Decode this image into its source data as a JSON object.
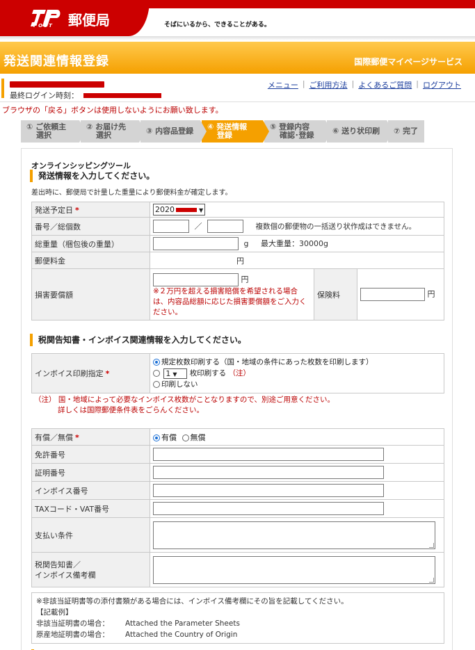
{
  "header": {
    "logo_post": "POST",
    "logo_name": "郵便局",
    "tagline": "そばにいるから、できることがある。"
  },
  "title_bar": {
    "title": "発送関連情報登録",
    "service": "国際郵便マイページサービス"
  },
  "user": {
    "last_login_label": "最終ログイン時刻：",
    "links": [
      "メニュー",
      "ご利用方法",
      "よくあるご質問",
      "ログアウト"
    ]
  },
  "notice": "ブラウザの「戻る」ボタンは使用しないようにお願い致します。",
  "steps": [
    {
      "line1": "① ご依頼主",
      "line2": "選択"
    },
    {
      "line1": "② お届け先",
      "line2": "選択"
    },
    {
      "line1": "③ 内容品登録",
      "line2": ""
    },
    {
      "line1": "④ 発送情報",
      "line2": "登録"
    },
    {
      "line1": "⑤ 登録内容",
      "line2": "確認･登録"
    },
    {
      "line1": "⑥ 送り状印刷",
      "line2": ""
    },
    {
      "line1": "⑦ 完了",
      "line2": ""
    }
  ],
  "active_step": 4,
  "colors": {
    "brand_red": "#cc0000",
    "accent_orange": "#f5a000",
    "link_blue": "#1a3c9c"
  },
  "shipping": {
    "tool_name": "オンラインシッピングツール",
    "heading": "発送情報を入力してください。",
    "description": "差出時に、郵便局で計量した重量により郵便料金が確定します。",
    "date_label": "発送予定日",
    "date_value": "2020",
    "count_label": "番号／総個数",
    "count_sep": "／",
    "count_note": "複数個の郵便物の一括送り状作成はできません。",
    "weight_label": "総重量（梱包後の重量）",
    "weight_unit": "g",
    "max_weight": "最大重量：30000g",
    "postage_label": "郵便料金",
    "postage_unit": "円",
    "damage_label": "損害要償額",
    "damage_unit": "円",
    "damage_note": "※２万円を超える損害賠償を希望される場合は、内容品総額に応じた損害要償額をご入力ください。",
    "insurance_label": "保険料",
    "insurance_unit": "円"
  },
  "invoice": {
    "heading": "税関告知書・インボイス関連情報を入力してください。",
    "print_label": "インボイス印刷指定",
    "opt1": "規定枚数印刷する（国・地域の条件にあった枚数を印刷します）",
    "opt2_count": "1",
    "opt2_suffix": "枚印刷する",
    "opt2_note": "（注）",
    "opt3": "印刷しない",
    "caution_line1": "（注）  国・地域によって必要なインボイス枚数がことなりますので、別途ご用意ください。",
    "caution_line2": "詳しくは国際郵便条件表をごらんください。",
    "paid_label": "有償／無償",
    "paid_opt1": "有償",
    "paid_opt2": "無償",
    "license_label": "免許番号",
    "cert_label": "証明番号",
    "invoice_no_label": "インボイス番号",
    "tax_label": "TAXコード・VAT番号",
    "payment_label": "支払い条件",
    "remarks_label1": "税関告知書／",
    "remarks_label2": "インボイス備考欄"
  },
  "example": {
    "intro": "※非該当証明書等の添付書類がある場合には、インボイス備考欄にその旨を記載してください。",
    "title": "【記載例】",
    "rows": [
      {
        "k": "非該当証明書の場合：",
        "v": "Attached the Parameter Sheets"
      },
      {
        "k": "原産地証明書の場合：",
        "v": "Attached the Country of Origin"
      }
    ]
  }
}
